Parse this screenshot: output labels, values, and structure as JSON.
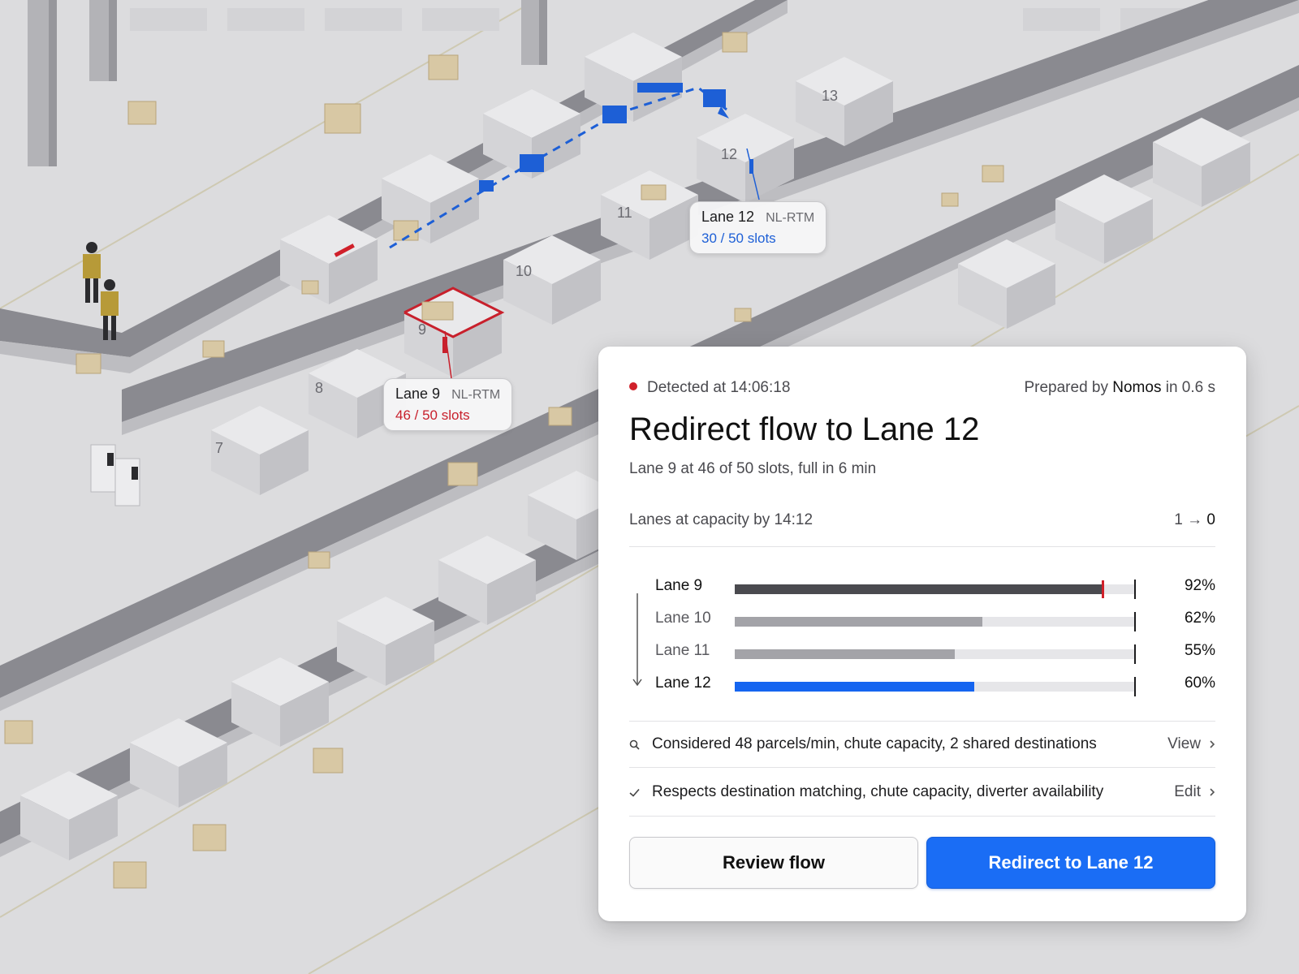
{
  "scene": {
    "chute_numbers": [
      "7",
      "8",
      "9",
      "10",
      "11",
      "12",
      "13"
    ],
    "callout_lane9": {
      "lane": "Lane 9",
      "code": "NL-RTM",
      "slots": "46 / 50 slots"
    },
    "callout_lane12": {
      "lane": "Lane 12",
      "code": "NL-RTM",
      "slots": "30 / 50 slots"
    }
  },
  "card": {
    "detected": "Detected at 14:06:18",
    "prepared_prefix": "Prepared by",
    "prepared_by": "Nomos",
    "prepared_suffix": "in 0.6 s",
    "title": "Redirect flow to Lane 12",
    "subtitle": "Lane 9 at 46 of 50 slots, full in 6 min",
    "capacity_label": "Lanes at capacity by 14:12",
    "capacity_from": "1",
    "capacity_arrow": "→",
    "capacity_to": "0",
    "lanes": [
      {
        "name": "Lane 9",
        "percent": "92%",
        "fill": 0.92,
        "state": "current"
      },
      {
        "name": "Lane 10",
        "percent": "62%",
        "fill": 0.62,
        "state": "normal"
      },
      {
        "name": "Lane 11",
        "percent": "55%",
        "fill": 0.55,
        "state": "normal"
      },
      {
        "name": "Lane 12",
        "percent": "60%",
        "fill": 0.6,
        "state": "target"
      }
    ],
    "considered": "Considered 48 parcels/min, chute capacity, 2 shared destinations",
    "considered_action": "View",
    "respects": "Respects destination matching, chute capacity, diverter availability",
    "respects_action": "Edit",
    "review_button": "Review flow",
    "redirect_button": "Redirect to Lane 12"
  },
  "colors": {
    "accent": "#1a6df5",
    "alert": "#d0202a",
    "route": "#1d5fd6"
  },
  "icons": [
    "search-icon",
    "check-icon",
    "chevron-right-icon",
    "alert-dot-icon",
    "flow-arrow-icon"
  ]
}
